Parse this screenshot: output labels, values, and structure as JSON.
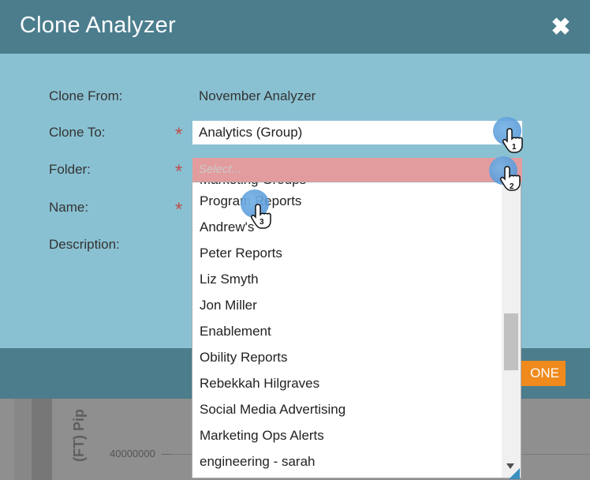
{
  "dialog": {
    "title": "Clone Analyzer",
    "close_label": "✖",
    "clone_button_label": "ONE"
  },
  "form": {
    "clone_from_label": "Clone From:",
    "clone_from_value": "November Analyzer",
    "clone_to_label": "Clone To:",
    "clone_to_value": "Analytics (Group)",
    "folder_label": "Folder:",
    "folder_placeholder": "Select...",
    "name_label": "Name:",
    "description_label": "Description:",
    "required_mark": "*"
  },
  "folder_dropdown": {
    "items": [
      "Program Reports",
      "Andrew's",
      "Peter Reports",
      "Liz Smyth",
      "Jon Miller",
      "Enablement",
      "Obility Reports",
      "Rebekkah Hilgraves",
      "Social Media Advertising",
      "Marketing Ops Alerts",
      "engineering - sarah"
    ]
  },
  "click_markers": [
    "1",
    "2",
    "3"
  ],
  "background_page": {
    "vertical_label": "(FT) Pip",
    "tick_label": "40000000"
  },
  "colors": {
    "header": "#4b7d8d",
    "body": "#89c1d2",
    "error_field": "#e39c9e",
    "accent_button": "#f08a1d",
    "required": "#c0504d"
  }
}
